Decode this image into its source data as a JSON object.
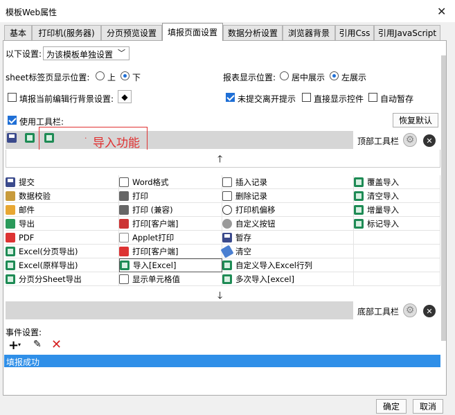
{
  "window": {
    "title": "模板Web属性",
    "close_icon": "close-icon"
  },
  "tabs": [
    {
      "label": "基本"
    },
    {
      "label": "打印机(服务器)"
    },
    {
      "label": "分页预览设置"
    },
    {
      "label": "填报页面设置"
    },
    {
      "label": "数据分析设置"
    },
    {
      "label": "浏览器背景"
    },
    {
      "label": "引用Css"
    },
    {
      "label": "引用JavaScript"
    }
  ],
  "settings": {
    "below_label": "以下设置:",
    "below_value": "为该模板单独设置",
    "sheet_pos_label": "sheet标签页显示位置:",
    "sheet_pos_top": "上",
    "sheet_pos_bottom": "下",
    "report_pos_label": "报表显示位置:",
    "report_pos_center": "居中展示",
    "report_pos_left": "左展示",
    "fill_bg_label": "填报当前编辑行背景设置:",
    "unsubmit_label": "未提交离开提示",
    "show_controls_label": "直接显示控件",
    "autosave_label": "自动暂存",
    "use_toolbar_label": "使用工具栏:",
    "restore_default": "恢复默认"
  },
  "annotation": {
    "text": "导入功能"
  },
  "toolbars": {
    "top_label": "顶部工具栏",
    "bottom_label": "底部工具栏"
  },
  "grid": {
    "columns": [
      [
        {
          "label": "提交",
          "icon": "save-icon"
        },
        {
          "label": "数据校验",
          "icon": "check-icon"
        },
        {
          "label": "邮件",
          "icon": "mail-icon"
        },
        {
          "label": "导出",
          "icon": "export-icon"
        },
        {
          "label": "PDF",
          "icon": "pdf-icon"
        },
        {
          "label": "Excel(分页导出)",
          "icon": "excel-icon"
        },
        {
          "label": "Excel(原样导出)",
          "icon": "excel-icon"
        },
        {
          "label": "分页分Sheet导出",
          "icon": "excel-icon"
        }
      ],
      [
        {
          "label": "Word格式",
          "icon": "word-icon"
        },
        {
          "label": "打印",
          "icon": "print-icon"
        },
        {
          "label": "打印 (兼容)",
          "icon": "print-icon"
        },
        {
          "label": "打印[客户端]",
          "icon": "print-pdf-icon"
        },
        {
          "label": "Applet打印",
          "icon": "applet-icon"
        },
        {
          "label": "打印[客户端]",
          "icon": "applet-print-icon"
        },
        {
          "label": "导入[Excel]",
          "icon": "excel-icon"
        },
        {
          "label": "显示单元格值",
          "icon": "blank-icon"
        }
      ],
      [
        {
          "label": "插入记录",
          "icon": "insert-row-icon"
        },
        {
          "label": "删除记录",
          "icon": "delete-row-icon"
        },
        {
          "label": "打印机偏移",
          "icon": "move-icon"
        },
        {
          "label": "自定义按钮",
          "icon": "gear-icon"
        },
        {
          "label": "暂存",
          "icon": "temp-save-icon"
        },
        {
          "label": "清空",
          "icon": "eraser-icon"
        },
        {
          "label": "自定义导入Excel行列",
          "icon": "excel-icon"
        },
        {
          "label": "多次导入[excel]",
          "icon": "excel-icon"
        }
      ],
      [
        {
          "label": "覆盖导入",
          "icon": "excel-icon"
        },
        {
          "label": "清空导入",
          "icon": "excel-icon"
        },
        {
          "label": "增量导入",
          "icon": "excel-icon"
        },
        {
          "label": "标记导入",
          "icon": "excel-icon"
        },
        {
          "label": "",
          "icon": ""
        },
        {
          "label": "",
          "icon": ""
        },
        {
          "label": "",
          "icon": ""
        },
        {
          "label": "",
          "icon": ""
        }
      ]
    ]
  },
  "events": {
    "label": "事件设置:",
    "items": [
      {
        "label": "填报成功"
      }
    ]
  },
  "footer": {
    "ok": "确定",
    "cancel": "取消"
  }
}
